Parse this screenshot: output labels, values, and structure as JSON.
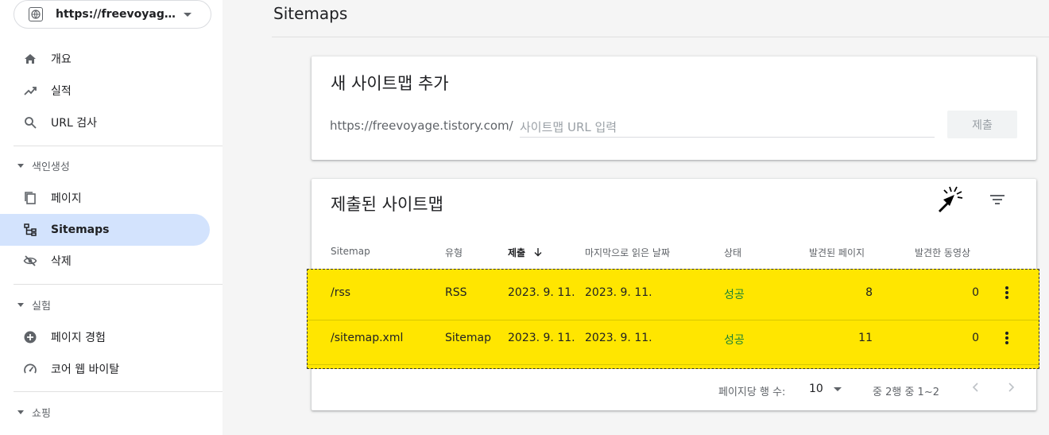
{
  "property": {
    "url": "https://freevoyage.t..."
  },
  "nav": {
    "overview": "개요",
    "performance": "실적",
    "url_inspection": "URL 검사",
    "section_indexing": "색인생성",
    "pages": "페이지",
    "sitemaps": "Sitemaps",
    "removals": "삭제",
    "section_experience": "실험",
    "page_experience": "페이지 경험",
    "core_web_vitals": "코어 웹 바이탈",
    "section_shopping": "쇼핑"
  },
  "page": {
    "title": "Sitemaps"
  },
  "add_sitemap": {
    "title": "새 사이트맵 추가",
    "prefix": "https://freevoyage.tistory.com/",
    "placeholder": "사이트맵 URL 입력",
    "submit_label": "제출"
  },
  "submitted": {
    "title": "제출된 사이트맵",
    "columns": {
      "sitemap": "Sitemap",
      "type": "유형",
      "submitted": "제출",
      "last_read": "마지막으로 읽은 날짜",
      "status": "상태",
      "discovered_pages": "발견된 페이지",
      "discovered_videos": "발견한 동영상"
    },
    "rows": [
      {
        "sitemap": "/rss",
        "type": "RSS",
        "submitted": "2023. 9. 11.",
        "last_read": "2023. 9. 11.",
        "status": "성공",
        "pages": "8",
        "videos": "0"
      },
      {
        "sitemap": "/sitemap.xml",
        "type": "Sitemap",
        "submitted": "2023. 9. 11.",
        "last_read": "2023. 9. 11.",
        "status": "성공",
        "pages": "11",
        "videos": "0"
      }
    ],
    "footer": {
      "rows_per_page_label": "페이지당 행 수:",
      "rows_per_page_value": "10",
      "range": "중 2행 중 1~2"
    }
  },
  "colors": {
    "accent": "#d3e3fd",
    "success": "#188038",
    "highlight": "#ffe600"
  }
}
